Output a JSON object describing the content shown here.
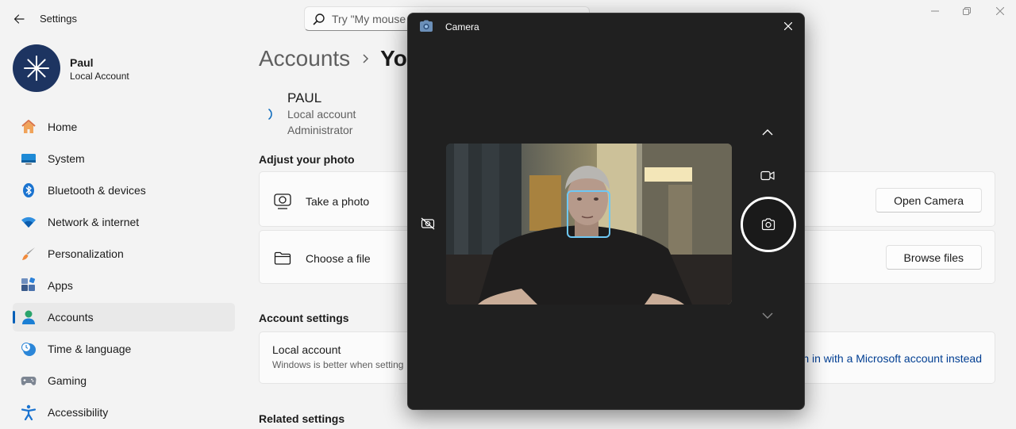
{
  "window": {
    "title": "Settings",
    "search_placeholder": "Try \"My mouse"
  },
  "profile": {
    "name": "Paul",
    "account_type": "Local Account"
  },
  "sidebar": {
    "items": [
      {
        "label": "Home",
        "icon": "home-icon"
      },
      {
        "label": "System",
        "icon": "system-icon"
      },
      {
        "label": "Bluetooth & devices",
        "icon": "bluetooth-icon"
      },
      {
        "label": "Network & internet",
        "icon": "wifi-icon"
      },
      {
        "label": "Personalization",
        "icon": "brush-icon"
      },
      {
        "label": "Apps",
        "icon": "apps-icon"
      },
      {
        "label": "Accounts",
        "icon": "accounts-icon",
        "active": true
      },
      {
        "label": "Time & language",
        "icon": "clock-globe-icon"
      },
      {
        "label": "Gaming",
        "icon": "gamepad-icon"
      },
      {
        "label": "Accessibility",
        "icon": "accessibility-icon"
      }
    ]
  },
  "main": {
    "breadcrumb_parent": "Accounts",
    "breadcrumb_current": "Yo",
    "user": {
      "name": "PAUL",
      "line1": "Local account",
      "line2": "Administrator"
    },
    "adjust_photo": {
      "heading": "Adjust your photo",
      "take_photo": {
        "label": "Take a photo",
        "button": "Open Camera"
      },
      "choose_file": {
        "label": "Choose a file",
        "button": "Browse files"
      }
    },
    "account_settings": {
      "heading": "Account settings",
      "local_title": "Local account",
      "local_sub": "Windows is better when setting",
      "ms_link": "n in with a Microsoft account instead"
    },
    "related_heading": "Related settings"
  },
  "camera": {
    "title": "Camera",
    "colors": {
      "background": "#202020",
      "face_box": "#6ec8f5"
    }
  },
  "colors": {
    "accent": "#005fb8",
    "link": "#003e92",
    "avatar_bg": "#1d3461"
  }
}
